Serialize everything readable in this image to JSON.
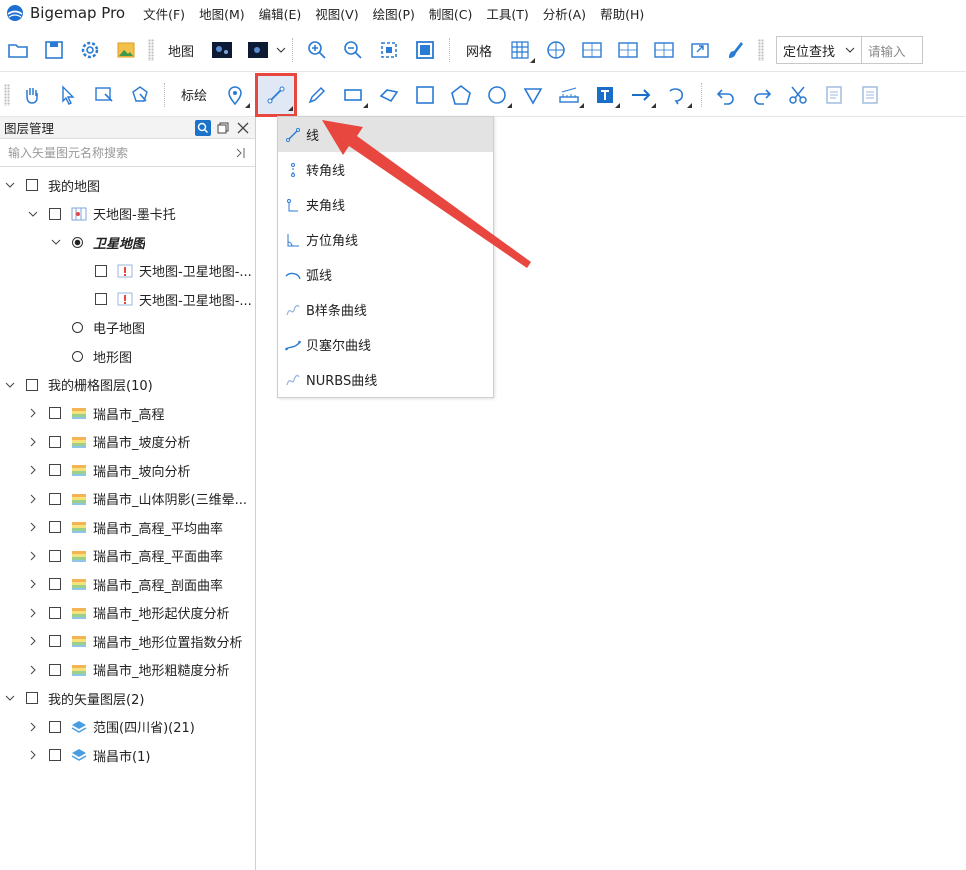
{
  "app": {
    "title": "Bigemap Pro"
  },
  "menu": [
    "文件(F)",
    "地图(M)",
    "编辑(E)",
    "视图(V)",
    "绘图(P)",
    "制图(C)",
    "工具(T)",
    "分析(A)",
    "帮助(H)"
  ],
  "toolbar1": {
    "map_label": "地图",
    "grid_label": "网格",
    "locate_select": "定位查找",
    "locate_placeholder": "请输入"
  },
  "toolbar2": {
    "annotate_label": "标绘"
  },
  "panel": {
    "title": "图层管理",
    "search_placeholder": "输入矢量图元名称搜索"
  },
  "tree": [
    {
      "label": "我的地图",
      "level": 0,
      "kind": "checkbox",
      "chevron": "down"
    },
    {
      "label": "天地图-墨卡托",
      "level": 1,
      "kind": "checkbox",
      "chevron": "down",
      "icon": "map-icon"
    },
    {
      "label": "卫星地图",
      "level": 2,
      "kind": "radio-on",
      "chevron": "down",
      "style": "bold-italic"
    },
    {
      "label": "天地图-卫星地图-...",
      "level": 3,
      "kind": "checkbox",
      "icon": "warning-map-icon"
    },
    {
      "label": "天地图-卫星地图-...",
      "level": 3,
      "kind": "checkbox",
      "icon": "warning-map-icon"
    },
    {
      "label": "电子地图",
      "level": 2,
      "kind": "radio"
    },
    {
      "label": "地形图",
      "level": 2,
      "kind": "radio"
    },
    {
      "label": "我的栅格图层(10)",
      "level": 0,
      "kind": "checkbox",
      "chevron": "down"
    },
    {
      "label": "瑞昌市_高程",
      "level": 1,
      "kind": "checkbox",
      "chevron": "right",
      "icon": "raster-icon"
    },
    {
      "label": "瑞昌市_坡度分析",
      "level": 1,
      "kind": "checkbox",
      "chevron": "right",
      "icon": "raster-icon"
    },
    {
      "label": "瑞昌市_坡向分析",
      "level": 1,
      "kind": "checkbox",
      "chevron": "right",
      "icon": "raster-icon"
    },
    {
      "label": "瑞昌市_山体阴影(三维晕...",
      "level": 1,
      "kind": "checkbox",
      "chevron": "right",
      "icon": "raster-icon"
    },
    {
      "label": "瑞昌市_高程_平均曲率",
      "level": 1,
      "kind": "checkbox",
      "chevron": "right",
      "icon": "raster-icon"
    },
    {
      "label": "瑞昌市_高程_平面曲率",
      "level": 1,
      "kind": "checkbox",
      "chevron": "right",
      "icon": "raster-icon"
    },
    {
      "label": "瑞昌市_高程_剖面曲率",
      "level": 1,
      "kind": "checkbox",
      "chevron": "right",
      "icon": "raster-icon"
    },
    {
      "label": "瑞昌市_地形起伏度分析",
      "level": 1,
      "kind": "checkbox",
      "chevron": "right",
      "icon": "raster-icon"
    },
    {
      "label": "瑞昌市_地形位置指数分析",
      "level": 1,
      "kind": "checkbox",
      "chevron": "right",
      "icon": "raster-icon"
    },
    {
      "label": "瑞昌市_地形粗糙度分析",
      "level": 1,
      "kind": "checkbox",
      "chevron": "right",
      "icon": "raster-icon"
    },
    {
      "label": "我的矢量图层(2)",
      "level": 0,
      "kind": "checkbox",
      "chevron": "down"
    },
    {
      "label": "范围(四川省)(21)",
      "level": 1,
      "kind": "checkbox",
      "chevron": "right",
      "icon": "layers-icon"
    },
    {
      "label": "瑞昌市(1)",
      "level": 1,
      "kind": "checkbox",
      "chevron": "right",
      "icon": "layers-icon"
    }
  ],
  "dropdown": {
    "items": [
      "线",
      "转角线",
      "夹角线",
      "方位角线",
      "弧线",
      "B样条曲线",
      "贝塞尔曲线",
      "NURBS曲线"
    ],
    "highlighted": "线"
  },
  "colors": {
    "accent": "#1a73c8",
    "annotation_red": "#e8473f"
  }
}
